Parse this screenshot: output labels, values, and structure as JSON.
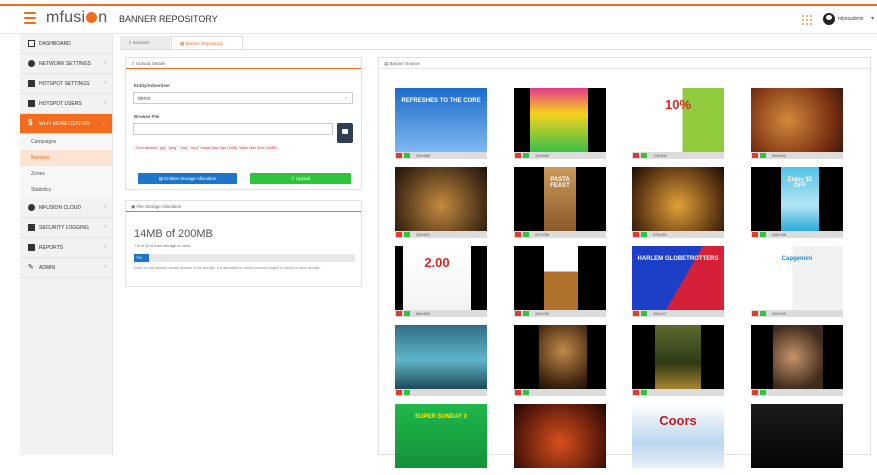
{
  "header": {
    "logo_text": "mfusi",
    "logo_tail": "n",
    "title": "BANNER REPOSITORY",
    "user": "mbssadmin"
  },
  "sidebar": {
    "items": [
      {
        "label": "DASHBOARD",
        "icon": "monitor-icon",
        "chevron": false
      },
      {
        "label": "NETWORK SETTINGS",
        "icon": "globe-icon",
        "chevron": true
      },
      {
        "label": "HOTSPOT SETTINGS",
        "icon": "hotspot-icon",
        "chevron": true
      },
      {
        "label": "HOTSPOT USERS",
        "icon": "users-icon",
        "chevron": true
      },
      {
        "label": "WI-FI MONETIZATION",
        "icon": "dollar-icon",
        "chevron": true,
        "active": true
      }
    ],
    "sub_items": [
      "Campaigns",
      "Banners",
      "Zones",
      "Statistics"
    ],
    "sub_active": "Banners",
    "items2": [
      {
        "label": "MFUSION CLOUD",
        "icon": "cloud-icon"
      },
      {
        "label": "SECURITY LOGGING",
        "icon": "lock-icon"
      },
      {
        "label": "REPORTS",
        "icon": "chart-icon"
      },
      {
        "label": "ADMIN",
        "icon": "wrench-icon"
      }
    ]
  },
  "tabs": [
    {
      "label": "Banners"
    },
    {
      "label": "Banner Repository",
      "active": true
    }
  ],
  "upload": {
    "header": "Upload Details",
    "entity_label": "Entity/Advertiser",
    "entity_value": "demo",
    "browse_label": "Browse File",
    "hint": "* Extn allowed: \"jpg\", \"jpeg\", \"png\", \"mp4\" Image Max Size (1MB), Video Max Size (10MB)",
    "btn_storage": "Entities Storage Allocation",
    "btn_upload": "Upload"
  },
  "storage": {
    "header": "File Storage Allocation",
    "used_text": "14MB of 200MB",
    "pct_text": "7% of your total storage is used.",
    "pct": 7,
    "bar_label": "7%",
    "note": "Entity is only allowed certain amount of file storage. It is advisable to delete unused images or videos to save storage."
  },
  "source": {
    "header": "Banner Source",
    "banners": [
      {
        "size": "320x568",
        "text": "REFRESHES TO THE CORE",
        "theme": "refresh"
      },
      {
        "size": "320x568",
        "text": "",
        "theme": "promo"
      },
      {
        "size": "728x540",
        "text": "10%",
        "theme": "ten"
      },
      {
        "size": "800x600",
        "text": "",
        "theme": "food"
      },
      {
        "size": "320x600",
        "text": "",
        "theme": "buffet"
      },
      {
        "size": "297x768",
        "text": "PASTA FEAST",
        "theme": "pasta"
      },
      {
        "size": "875x400",
        "text": "",
        "theme": "beer"
      },
      {
        "size": "266x768",
        "text": "Enjoy $2 OFF",
        "theme": "man"
      },
      {
        "size": "800x600",
        "text": "2.00",
        "theme": "special"
      },
      {
        "size": "320x768",
        "text": "",
        "theme": "dog"
      },
      {
        "size": "300x127",
        "text": "HARLEM GLOBETROTTERS",
        "theme": "harlem"
      },
      {
        "size": "300x129",
        "text": "Capgemini",
        "theme": "rugby"
      },
      {
        "size": "",
        "text": "",
        "theme": "sea"
      },
      {
        "size": "",
        "text": "",
        "theme": "restaurant"
      },
      {
        "size": "",
        "text": "",
        "theme": "forest"
      },
      {
        "size": "",
        "text": "",
        "theme": "spa"
      },
      {
        "size": "",
        "text": "SUPER SUNDAY 3",
        "theme": "sunday"
      },
      {
        "size": "",
        "text": "",
        "theme": "menu"
      },
      {
        "size": "",
        "text": "Coors",
        "theme": "coors"
      },
      {
        "size": "",
        "text": "",
        "theme": "jaguar"
      }
    ]
  }
}
